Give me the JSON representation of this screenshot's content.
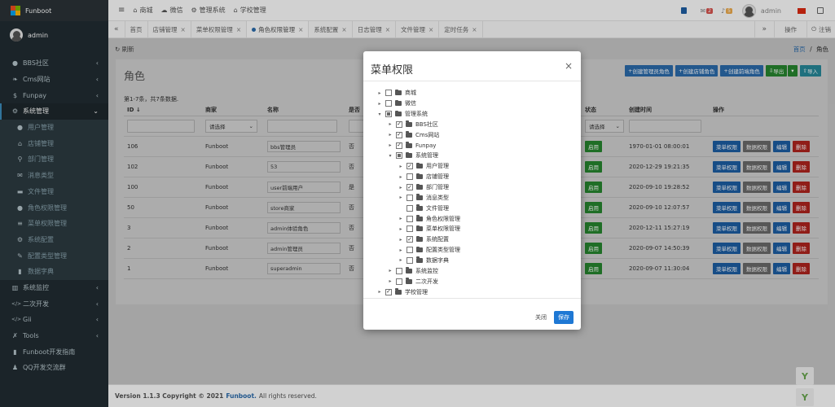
{
  "app": {
    "name": "Funboot",
    "user": "admin"
  },
  "sidebar": {
    "items": [
      {
        "label": "BBS社区",
        "icon": "comment-icon",
        "arrow": true
      },
      {
        "label": "Cms网站",
        "icon": "leaf-icon",
        "arrow": true
      },
      {
        "label": "Funpay",
        "icon": "dollar-icon",
        "arrow": true
      },
      {
        "label": "系统管理",
        "icon": "cogs-icon",
        "arrow": true,
        "active": true
      },
      {
        "label": "用户管理",
        "icon": "user-icon",
        "sub": true
      },
      {
        "label": "店铺管理",
        "icon": "shop-icon",
        "sub": true
      },
      {
        "label": "部门管理",
        "icon": "sitemap-icon",
        "sub": true
      },
      {
        "label": "消息类型",
        "icon": "envelope-icon",
        "sub": true
      },
      {
        "label": "文件管理",
        "icon": "folder-icon",
        "sub": true
      },
      {
        "label": "角色权限管理",
        "icon": "users-icon",
        "sub": true
      },
      {
        "label": "菜单权限管理",
        "icon": "menu-icon",
        "sub": true
      },
      {
        "label": "系统配置",
        "icon": "gear-icon",
        "sub": true
      },
      {
        "label": "配置类型管理",
        "icon": "edit-icon",
        "sub": true
      },
      {
        "label": "数据字典",
        "icon": "book-icon",
        "sub": true
      },
      {
        "label": "系统监控",
        "icon": "chart-icon",
        "arrow": true
      },
      {
        "label": "二次开发",
        "icon": "code-icon",
        "arrow": true
      },
      {
        "label": "Gii",
        "icon": "code-icon",
        "arrow": true
      },
      {
        "label": "Tools",
        "icon": "wrench-icon",
        "arrow": true
      },
      {
        "label": "Funboot开发指南",
        "icon": "book-icon"
      },
      {
        "label": "QQ开发交流群",
        "icon": "qq-icon"
      }
    ]
  },
  "topbar": {
    "menu_icon": "≡",
    "links": [
      {
        "label": "商城",
        "icon": "shop-icon"
      },
      {
        "label": "微信",
        "icon": "wechat-icon"
      },
      {
        "label": "管理系统",
        "icon": "gear-icon"
      },
      {
        "label": "学校管理",
        "icon": "school-icon"
      }
    ],
    "badge_msg": "2",
    "badge_notice": "5",
    "user": "admin"
  },
  "tabs": {
    "items": [
      {
        "label": "首页",
        "closable": false
      },
      {
        "label": "店铺管理",
        "closable": true
      },
      {
        "label": "菜单权限管理",
        "closable": true
      },
      {
        "label": "角色权限管理",
        "closable": true,
        "active": true
      },
      {
        "label": "系统配置",
        "closable": true
      },
      {
        "label": "日志管理",
        "closable": true
      },
      {
        "label": "文件管理",
        "closable": true
      },
      {
        "label": "定时任务",
        "closable": true
      }
    ],
    "ops": "操作",
    "logout": "注销"
  },
  "content": {
    "refresh": "刷新",
    "breadcrumb_home": "首页",
    "breadcrumb_current": "角色",
    "title": "角色",
    "buttons": [
      "创建管理员角色",
      "创建店铺角色",
      "创建前端角色",
      "导出",
      "导入"
    ],
    "summary": "第1-7条，共7条数据.",
    "columns": [
      "ID ↓",
      "商家",
      "名称",
      "是否",
      "状态",
      "创建时间",
      "操作"
    ],
    "filter_select": "请选择",
    "rows": [
      {
        "id": "106",
        "store": "Funboot",
        "name": "bbs管理员",
        "flag": "否",
        "status": "启用",
        "time": "1970-01-01 08:00:01"
      },
      {
        "id": "102",
        "store": "Funboot",
        "name": "53",
        "flag": "否",
        "status": "启用",
        "time": "2020-12-29 19:21:35"
      },
      {
        "id": "100",
        "store": "Funboot",
        "name": "user前端用户",
        "flag": "是",
        "status": "启用",
        "time": "2020-09-10 19:28:52"
      },
      {
        "id": "50",
        "store": "Funboot",
        "name": "store商家",
        "flag": "否",
        "status": "启用",
        "time": "2020-09-10 12:07:57"
      },
      {
        "id": "3",
        "store": "Funboot",
        "name": "admin体验角色",
        "flag": "否",
        "status": "启用",
        "time": "2020-12-11 15:27:19"
      },
      {
        "id": "2",
        "store": "Funboot",
        "name": "admin管理员",
        "flag": "否",
        "status": "启用",
        "time": "2020-09-07 14:50:39"
      },
      {
        "id": "1",
        "store": "Funboot",
        "name": "superadmin",
        "flag": "否",
        "status": "启用",
        "time": "2020-09-07 11:30:04"
      }
    ],
    "row_actions": [
      "菜单权限",
      "数据权限",
      "编辑",
      "删除"
    ]
  },
  "modal": {
    "title": "菜单权限",
    "close": "×",
    "tree": [
      {
        "label": "商城",
        "level": 0,
        "toggle": "▸",
        "check": "none"
      },
      {
        "label": "微信",
        "level": 0,
        "toggle": "▸",
        "check": "none"
      },
      {
        "label": "管理系统",
        "level": 0,
        "toggle": "▾",
        "check": "partial"
      },
      {
        "label": "BBS社区",
        "level": 1,
        "toggle": "▸",
        "check": "checked"
      },
      {
        "label": "Cms网站",
        "level": 1,
        "toggle": "▸",
        "check": "checked"
      },
      {
        "label": "Funpay",
        "level": 1,
        "toggle": "▸",
        "check": "checked"
      },
      {
        "label": "系统管理",
        "level": 1,
        "toggle": "▾",
        "check": "partial"
      },
      {
        "label": "用户管理",
        "level": 2,
        "toggle": "▸",
        "check": "checked"
      },
      {
        "label": "店铺管理",
        "level": 2,
        "toggle": "▸",
        "check": "none"
      },
      {
        "label": "部门管理",
        "level": 2,
        "toggle": "▸",
        "check": "checked"
      },
      {
        "label": "消息类型",
        "level": 2,
        "toggle": "▸",
        "check": "none"
      },
      {
        "label": "文件管理",
        "level": 2,
        "toggle": "",
        "check": "none"
      },
      {
        "label": "角色权限管理",
        "level": 2,
        "toggle": "▸",
        "check": "none"
      },
      {
        "label": "菜单权限管理",
        "level": 2,
        "toggle": "▸",
        "check": "none"
      },
      {
        "label": "系统配置",
        "level": 2,
        "toggle": "▸",
        "check": "checked"
      },
      {
        "label": "配置类型管理",
        "level": 2,
        "toggle": "▸",
        "check": "none"
      },
      {
        "label": "数据字典",
        "level": 2,
        "toggle": "▸",
        "check": "none"
      },
      {
        "label": "系统监控",
        "level": 1,
        "toggle": "▸",
        "check": "none"
      },
      {
        "label": "二次开发",
        "level": 1,
        "toggle": "▸",
        "check": "none"
      },
      {
        "label": "学校管理",
        "level": 0,
        "toggle": "▸",
        "check": "checked"
      }
    ],
    "close_label": "关闭",
    "save_label": "保存"
  },
  "footer": {
    "version": "Version 1.1.3 Copyright © 2021",
    "brand": "Funboot.",
    "rights": "All rights reserved."
  },
  "colors": {
    "sidebar_bg": "#222d32",
    "primary": "#1e78d4",
    "success": "#27872f",
    "danger": "#b0241e"
  }
}
